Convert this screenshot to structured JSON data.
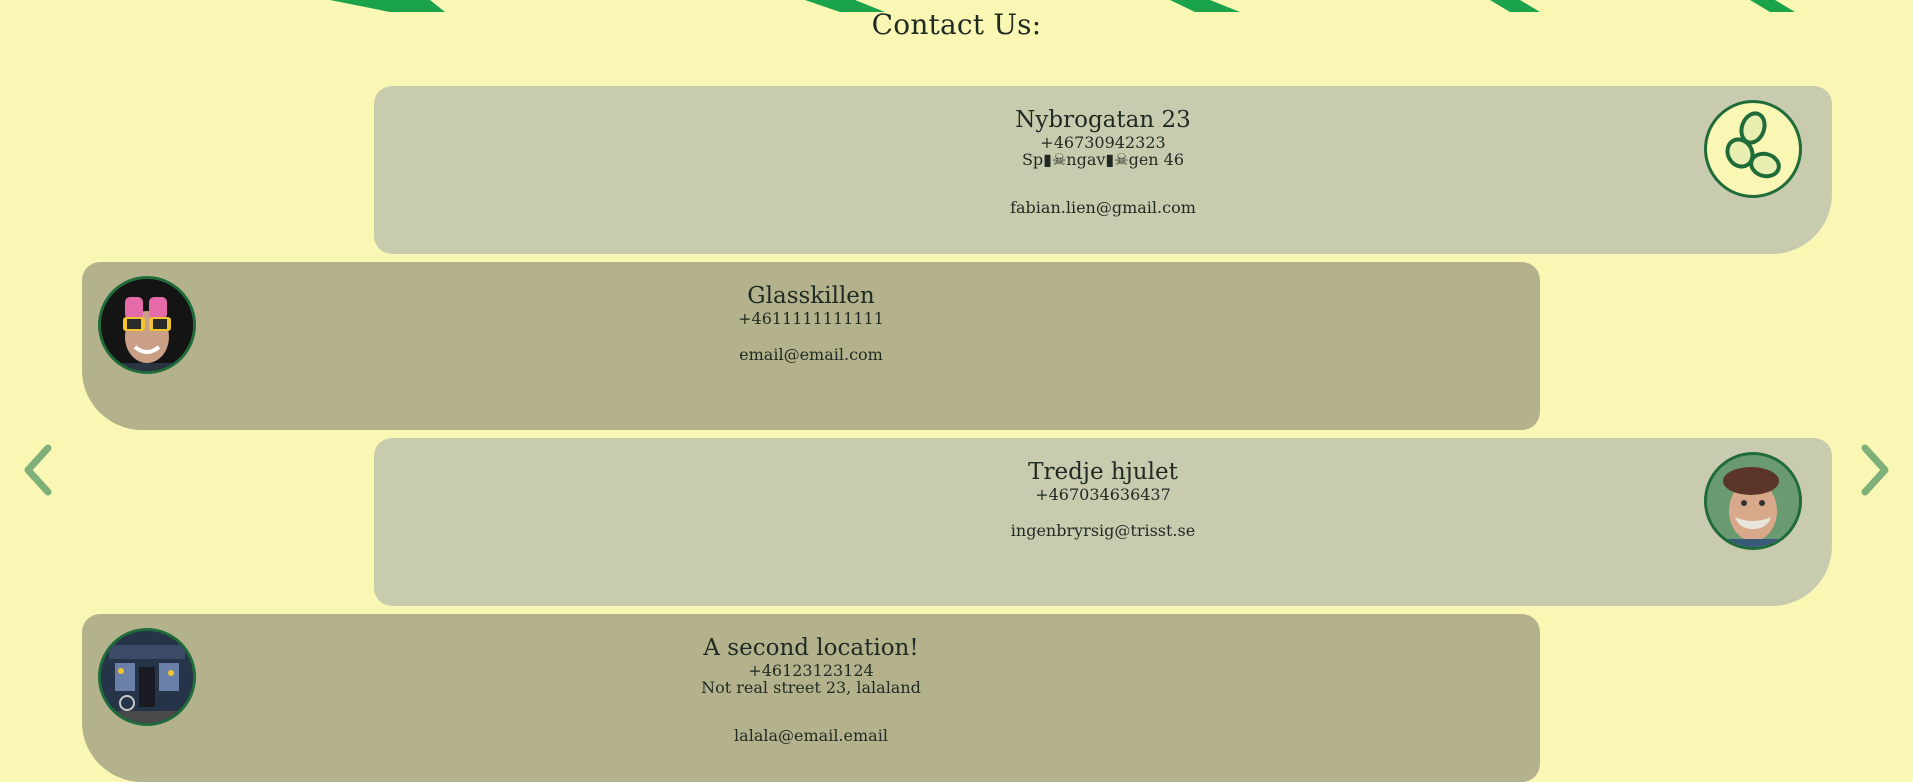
{
  "page": {
    "title": "Contact Us:"
  },
  "colors": {
    "background": "#faf6b4",
    "card_light": "#c9cbaf",
    "card_dark": "#b3b28d",
    "accent_green": "#1f6b3a",
    "stripe_green": "#1aa34a",
    "arrow_green": "#7fb07a"
  },
  "navigation": {
    "prev_icon": "chevron-left-icon",
    "next_icon": "chevron-right-icon"
  },
  "contacts": [
    {
      "name": "Nybrogatan 23",
      "phone": "+46730942323",
      "address": "Sp▮☠ngav▮☠gen 46",
      "email": "fabian.lien@gmail.com",
      "avatar_icon": "rings-logo-icon"
    },
    {
      "name": "Glasskillen",
      "phone": "+4611111111111",
      "address": "",
      "email": "email@email.com",
      "avatar_icon": "person-sunglasses-avatar"
    },
    {
      "name": "Tredje hjulet",
      "phone": "+467034636437",
      "address": "",
      "email": "ingenbryrsig@trisst.se",
      "avatar_icon": "elderly-man-avatar"
    },
    {
      "name": "A second location!",
      "phone": "+46123123124",
      "address": "Not real street 23, lalaland",
      "email": "lalala@email.email",
      "avatar_icon": "storefront-avatar"
    }
  ]
}
